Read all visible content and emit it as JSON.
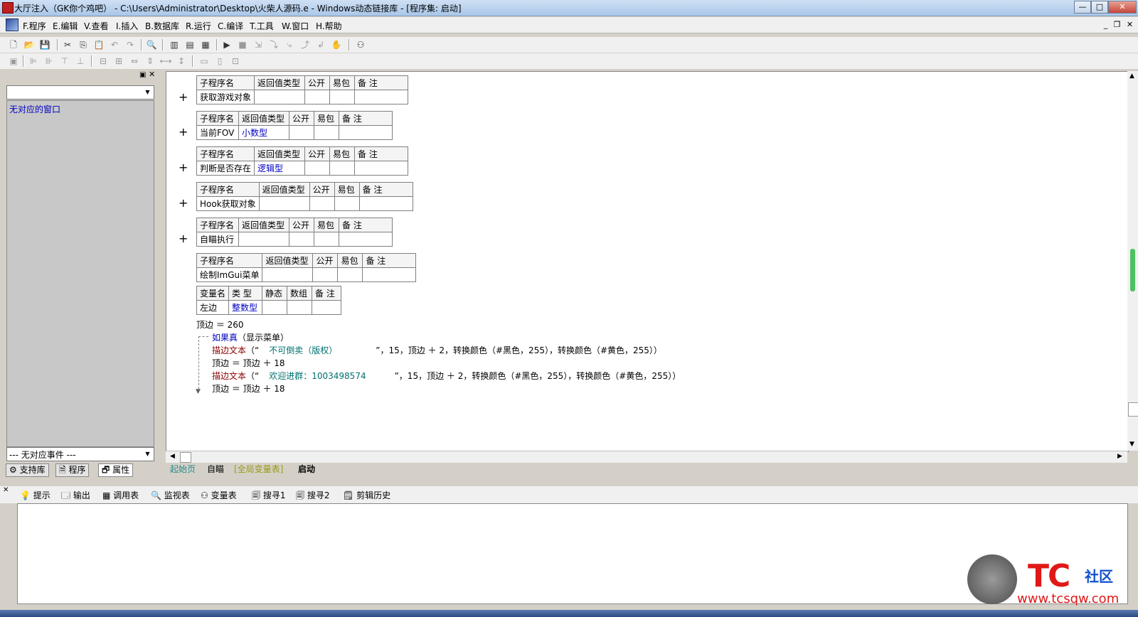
{
  "window": {
    "title": "大厅注入（GK你个鸡吧） - C:\\Users\\Administrator\\Desktop\\火柴人源码.e - Windows动态链接库 - [程序集: 启动]",
    "buttons": {
      "min": "—",
      "max": "□",
      "close": "✕"
    }
  },
  "menu": {
    "items": [
      "F.程序",
      "E.编辑",
      "V.查看",
      "I.插入",
      "B.数据库",
      "R.运行",
      "C.编译",
      "T.工具",
      "W.窗口",
      "H.帮助"
    ],
    "mdi": {
      "min": "_",
      "restore": "❐",
      "close": "✕"
    }
  },
  "left": {
    "list_text": "无对应的窗口",
    "event_combo": "--- 无对应事件 ---",
    "tabs": [
      "支持库",
      "程序",
      "属性"
    ]
  },
  "editor": {
    "header": {
      "name": "子程序名",
      "ret": "返回值类型",
      "pub": "公开",
      "pkg": "易包",
      "note": "备 注"
    },
    "subs": [
      {
        "name": "获取游戏对象",
        "ret": ""
      },
      {
        "name": "当前FOV",
        "ret": "小数型"
      },
      {
        "name": "判断是否存在",
        "ret": "逻辑型"
      },
      {
        "name": "Hook获取对象",
        "ret": ""
      },
      {
        "name": "自瞄执行",
        "ret": ""
      },
      {
        "name": "绘制ImGui菜单",
        "ret": ""
      }
    ],
    "var_header": {
      "name": "变量名",
      "type": "类 型",
      "static": "静态",
      "array": "数组",
      "note": "备 注"
    },
    "var": {
      "name": "左边",
      "type": "整数型"
    },
    "code": {
      "line1": "顶边 ＝ 260",
      "line2_kw": "如果真",
      "line2_rest": "（显示菜单）",
      "line3_fn": "描边文本",
      "line3_open": "（“",
      "line3_str": "不可倒卖（版权）",
      "line3_rest": "”，15，顶边 ＋ 2，转换颜色（#黑色，255），转换颜色（#黄色，255））",
      "line4": "顶边 ＝ 顶边 ＋ 18",
      "line5_fn": "描边文本",
      "line5_open": "（“",
      "line5_str": "欢迎进群：1003498574",
      "line5_rest": "”，15，顶边 ＋ 2，转换颜色（#黑色，255），转换颜色（#黄色，255））",
      "line6": "顶边 ＝ 顶边 ＋ 18"
    },
    "tabs": [
      "起始页",
      "自瞄",
      "[全局变量表]",
      "启动"
    ]
  },
  "bottom": {
    "tabs": [
      "提示",
      "输出",
      "调用表",
      "监视表",
      "变量表",
      "搜寻1",
      "搜寻2",
      "剪辑历史"
    ]
  },
  "watermark": {
    "brand": "TC",
    "community": "社区",
    "url": "www.tcsqw.com"
  },
  "colors": {
    "keyword": "#8b0000",
    "type": "#0000c0",
    "string": "#007070"
  }
}
